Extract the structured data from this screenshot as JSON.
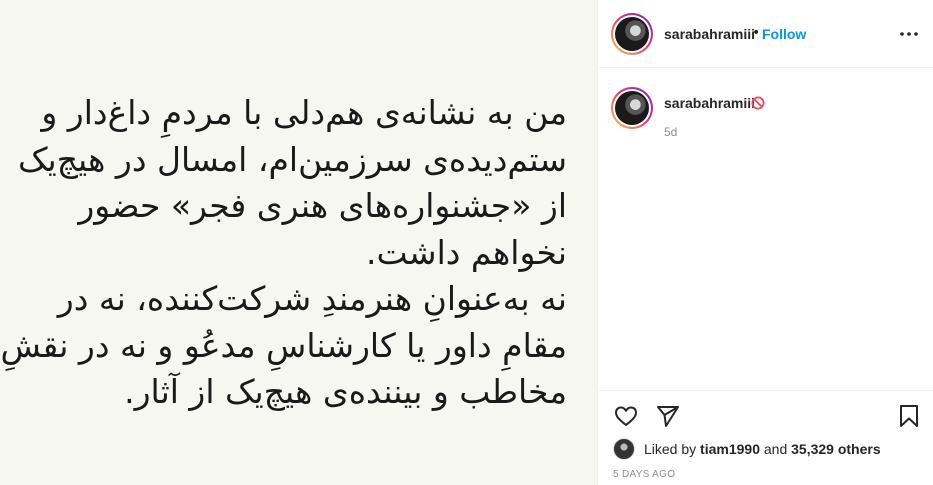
{
  "post": {
    "image_text": [
      "من به نشانه‌ی هم‌دلی با مردمِ داغ‌دار و",
      "ستم‌دیده‌ی سرزمین‌ام، امسال در هیچ‌یک",
      "از «جشنواره‌های هنری فجر» حضور",
      "نخواهم داشت.",
      "نه به‌عنوانِ هنرمندِ شرکت‌کننده، نه در",
      "مقامِ داور یا کارشناسِ مدعُو و نه در نقشِ",
      "مخاطب و بیننده‌ی هیچ‌یک از آثار."
    ]
  },
  "header": {
    "username": "sarabahramiii",
    "separator": "•",
    "follow_label": "Follow",
    "more_icon": "more-horizontal-icon"
  },
  "caption": {
    "username": "sarabahramiii",
    "badge_icon": "no-entry-icon",
    "time": "5d"
  },
  "actions": {
    "like_icon": "heart-icon",
    "share_icon": "paper-plane-icon",
    "save_icon": "bookmark-icon"
  },
  "likes": {
    "prefix": "Liked by ",
    "user": "tiam1990",
    "conjunction": " and ",
    "count_text": "35,329 others"
  },
  "date": "5 DAYS AGO",
  "colors": {
    "accent": "#0095f6",
    "no_entry": "#ed4956",
    "secondary_text": "#8e8e8e"
  }
}
